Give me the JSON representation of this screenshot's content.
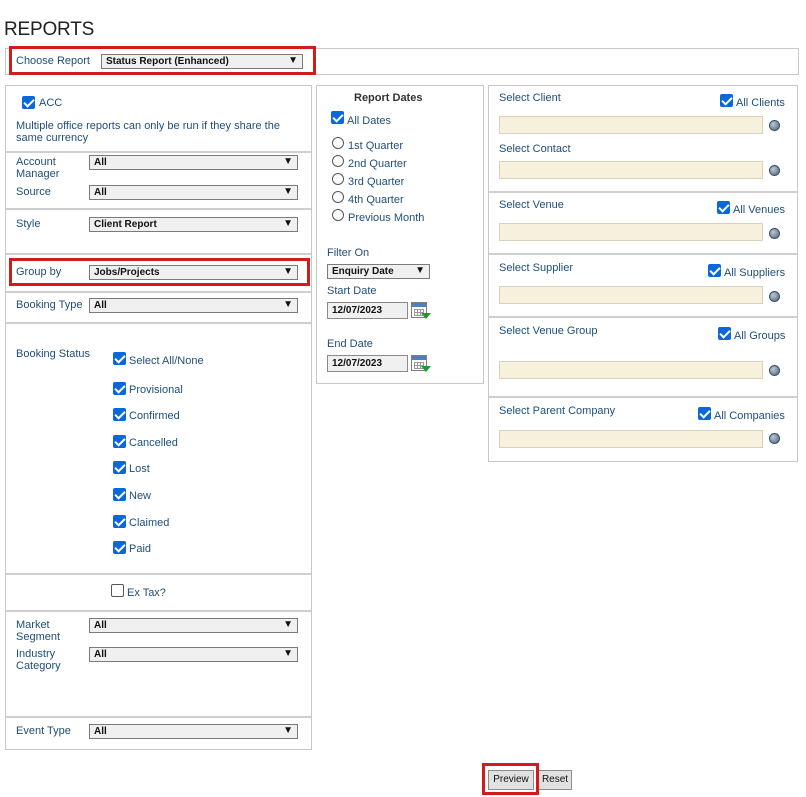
{
  "page_title": "REPORTS",
  "choose_report": {
    "label": "Choose Report",
    "value": "Status Report (Enhanced)"
  },
  "left": {
    "acc_label": "ACC",
    "note": "Multiple office reports can only be run if they share the same currency",
    "account_manager": {
      "label_1": "Account",
      "label_2": "Manager",
      "value": "All"
    },
    "source": {
      "label": "Source",
      "value": "All"
    },
    "style": {
      "label": "Style",
      "value": "Client Report"
    },
    "group_by": {
      "label": "Group by",
      "value": "Jobs/Projects"
    },
    "booking_type": {
      "label": "Booking Type",
      "value": "All"
    },
    "booking_status": {
      "label": "Booking Status",
      "options": [
        "Select All/None",
        "Provisional",
        "Confirmed",
        "Cancelled",
        "Lost",
        "New",
        "Claimed",
        "Paid"
      ]
    },
    "ex_tax_label": "Ex Tax?",
    "market_segment": {
      "label_1": "Market",
      "label_2": "Segment",
      "value": "All"
    },
    "industry_category": {
      "label_1": "Industry",
      "label_2": "Category",
      "value": "All"
    },
    "event_type": {
      "label": "Event Type",
      "value": "All"
    }
  },
  "dates": {
    "heading": "Report Dates",
    "all_dates_label": "All Dates",
    "quarters": [
      "1st Quarter",
      "2nd Quarter",
      "3rd Quarter",
      "4th Quarter",
      "Previous Month"
    ],
    "filter_on_label": "Filter On",
    "filter_on_value": "Enquiry Date",
    "start_date_label": "Start Date",
    "start_date_value": "12/07/2023",
    "end_date_label": "End Date",
    "end_date_value": "12/07/2023"
  },
  "right": {
    "select_client": "Select Client",
    "all_clients": "All Clients",
    "select_contact": "Select Contact",
    "select_venue": "Select Venue",
    "all_venues": "All Venues",
    "select_supplier": "Select Supplier",
    "all_suppliers": "All Suppliers",
    "select_venue_group": "Select Venue Group",
    "all_groups": "All Groups",
    "select_parent_company": "Select Parent Company",
    "all_companies": "All Companies"
  },
  "buttons": {
    "preview": "Preview",
    "reset": "Reset"
  },
  "colors": {
    "label": "#1f4e79",
    "highlight": "#d11c1c",
    "checkbox": "#0b68d8",
    "field_bg": "#f7f1dc"
  }
}
